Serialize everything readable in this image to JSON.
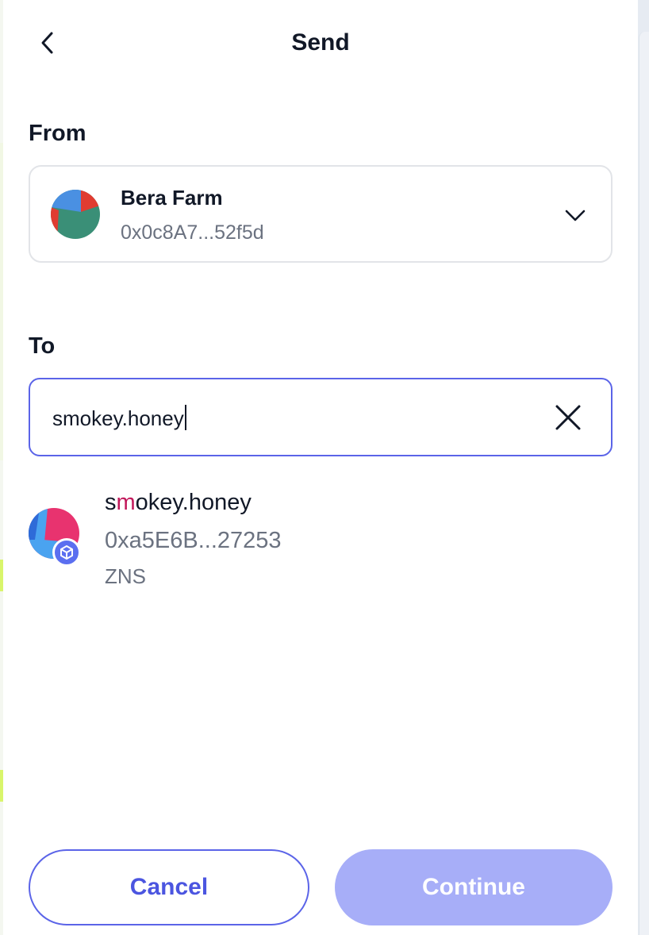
{
  "header": {
    "title": "Send"
  },
  "from": {
    "label": "From",
    "account_name": "Bera Farm",
    "account_address": "0x0c8A7...52f5d"
  },
  "to": {
    "label": "To",
    "input_value": "smokey.honey"
  },
  "result": {
    "name_prefix": "s",
    "name_highlight": "m",
    "name_suffix": "okey.honey",
    "address": "0xa5E6B...27253",
    "source": "ZNS"
  },
  "actions": {
    "cancel_label": "Cancel",
    "continue_label": "Continue"
  },
  "colors": {
    "accent": "#5b64e8",
    "continue_disabled": "#a7aef8",
    "match_highlight": "#c2185b"
  }
}
